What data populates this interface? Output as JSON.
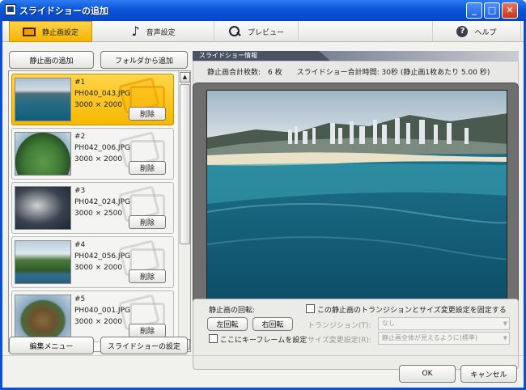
{
  "window": {
    "title": "スライドショーの追加"
  },
  "tabs": [
    {
      "label": "静止画設定",
      "icon": "still-image-icon",
      "active": true
    },
    {
      "label": "音声設定",
      "icon": "music-note-icon"
    },
    {
      "label": "プレビュー",
      "icon": "preview-magnifier-icon"
    },
    {
      "label": "ヘルプ",
      "icon": "help-icon"
    }
  ],
  "left": {
    "add_image_button": "静止画の追加",
    "add_folder_button": "フォルダから追加",
    "edit_menu_button": "編集メニュー",
    "slideshow_settings_button": "スライドショーの設定"
  },
  "images": [
    {
      "num": "#1",
      "filename": "PH040_043.JPG",
      "size": "3000 × 2000",
      "delete": "削除",
      "selected": true
    },
    {
      "num": "#2",
      "filename": "PH042_006.JPG",
      "size": "3000 × 2000",
      "delete": "削除"
    },
    {
      "num": "#3",
      "filename": "PH042_024.JPG",
      "size": "3000 × 2500",
      "delete": "削除"
    },
    {
      "num": "#4",
      "filename": "PH042_056.JPG",
      "size": "3000 × 2000",
      "delete": "削除"
    },
    {
      "num": "#5",
      "filename": "PH040_001.JPG",
      "size": "3000 × 2000",
      "delete": "削除"
    }
  ],
  "info": {
    "header": "スライドショー情報",
    "line": "静止画合計枚数:　6 枚　　スライドショー合計時間: 30秒 (静止画1枚あたり 5.00 秒)"
  },
  "rotation": {
    "label": "静止画の回転:",
    "left_button": "左回転",
    "right_button": "右回転",
    "keyframe_checkbox": "ここにキーフレームを設定"
  },
  "transition": {
    "fix_checkbox": "この静止画のトランジションとサイズ変更設定を固定する",
    "transition_label": "トランジション(T):",
    "transition_value": "なし",
    "resize_label": "サイズ変更設定(R):",
    "resize_value": "静止画全体が見えるように(標準)"
  },
  "footer": {
    "ok": "OK",
    "cancel": "キャンセル"
  }
}
